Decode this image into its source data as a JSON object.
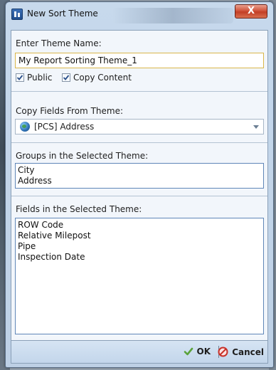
{
  "window": {
    "title": "New Sort Theme",
    "close_label": "X"
  },
  "theme_name": {
    "label": "Enter Theme Name:",
    "value": "My Report Sorting Theme_1"
  },
  "options": {
    "public_label": "Public",
    "public_checked": true,
    "copy_content_label": "Copy Content",
    "copy_content_checked": true
  },
  "copy_fields": {
    "label": "Copy Fields From Theme:",
    "selected": "[PCS] Address",
    "icon": "globe-icon"
  },
  "groups": {
    "label": "Groups in the Selected Theme:",
    "items": [
      "City",
      "Address"
    ]
  },
  "fields": {
    "label": "Fields in the Selected Theme:",
    "items": [
      "ROW Code",
      "Relative Milepost",
      "Pipe",
      "Inspection Date"
    ]
  },
  "footer": {
    "ok_label": "OK",
    "cancel_label": "Cancel"
  },
  "colors": {
    "accent_border": "#d9b64a",
    "list_border": "#5f86b8",
    "close_red": "#c23e25"
  }
}
